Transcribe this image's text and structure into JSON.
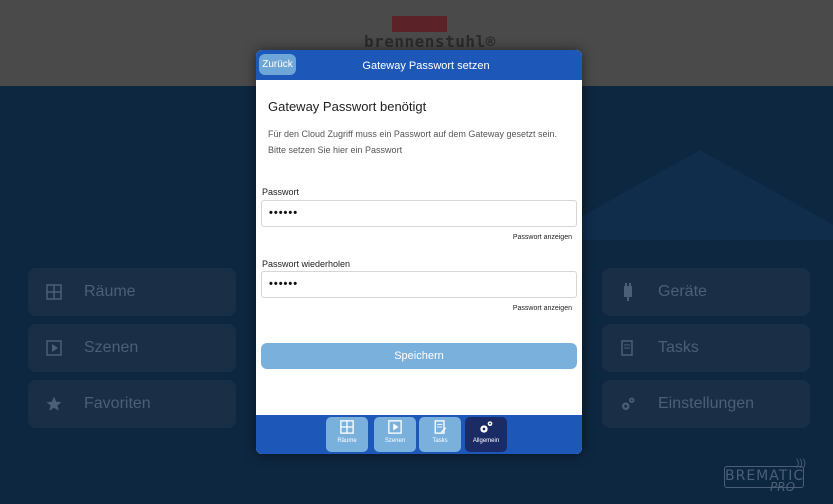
{
  "header": {
    "brand_name": "brennenstuhl®"
  },
  "background_tiles": {
    "left": [
      {
        "label": "Räume",
        "icon": "rooms-icon"
      },
      {
        "label": "Szenen",
        "icon": "scenes-icon"
      },
      {
        "label": "Favoriten",
        "icon": "star-icon"
      }
    ],
    "right": [
      {
        "label": "Geräte",
        "icon": "plug-icon"
      },
      {
        "label": "Tasks",
        "icon": "tasks-icon"
      },
      {
        "label": "Einstellungen",
        "icon": "gears-icon"
      }
    ]
  },
  "footer_brand": {
    "name": "BREMATIC",
    "sub": "PRO"
  },
  "modal": {
    "back_label": "Zurück",
    "title": "Gateway Passwort setzen",
    "section_title": "Gateway Passwort benötigt",
    "description": "Für den Cloud Zugriff muss ein Passwort auf dem Gateway gesetzt sein. Bitte setzen Sie hier ein Passwort",
    "password_label": "Passwort",
    "password_value": "••••••",
    "password_show": "Passwort anzeigen",
    "repeat_label": "Passwort wiederholen",
    "repeat_value": "••••••",
    "repeat_show": "Passwort anzeigen",
    "save_label": "Speichern"
  },
  "tabbar": {
    "tabs": [
      {
        "label": "Räume",
        "icon": "rooms-icon",
        "active": false
      },
      {
        "label": "Szenen",
        "icon": "play-icon",
        "active": false
      },
      {
        "label": "Tasks",
        "icon": "tasks-icon",
        "active": false
      },
      {
        "label": "Allgemein",
        "icon": "gears-icon",
        "active": true
      }
    ]
  },
  "colors": {
    "modal_header": "#1d58b8",
    "button": "#7ab0dc",
    "active_tab": "#1a2b66",
    "background": "#0e2740"
  }
}
